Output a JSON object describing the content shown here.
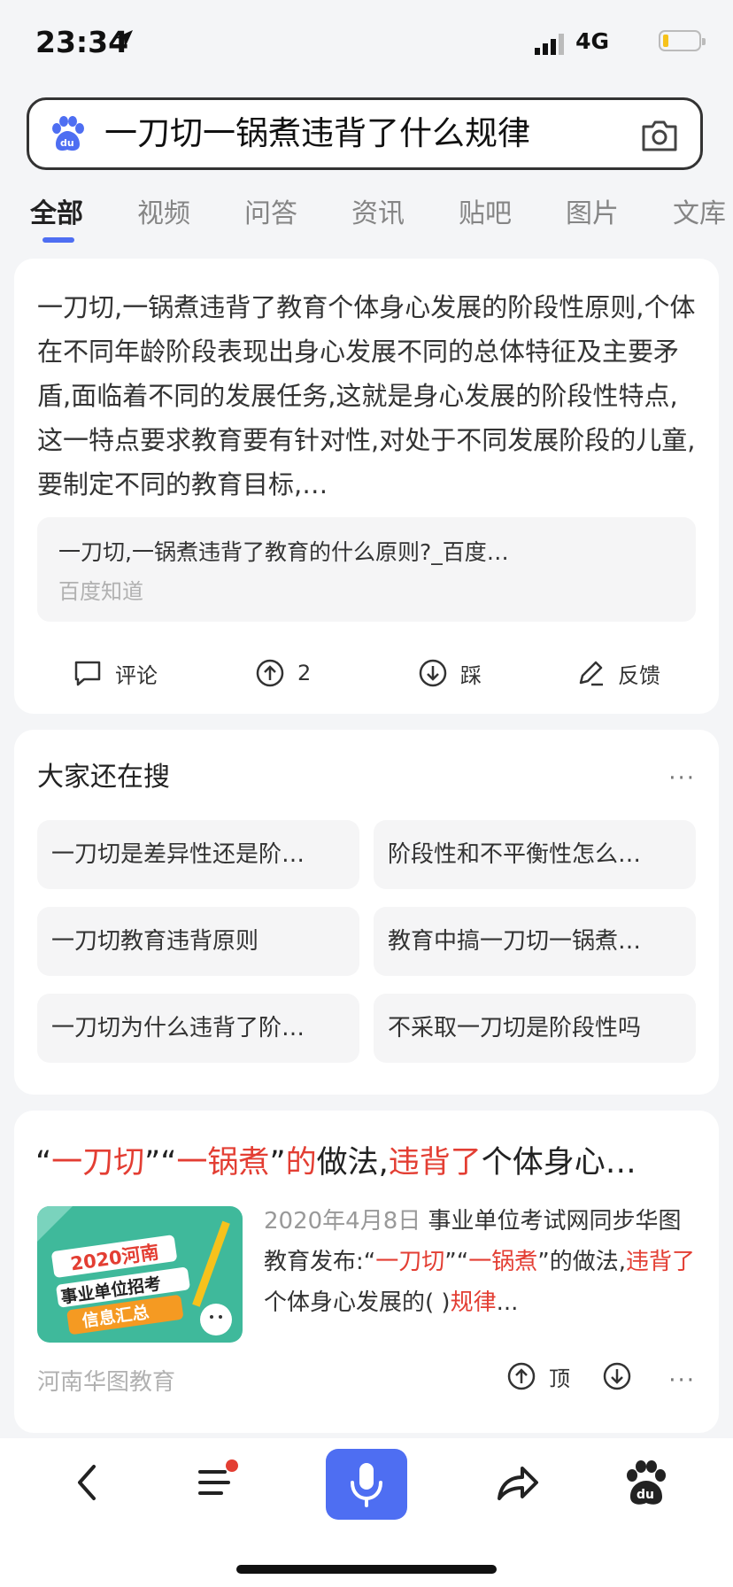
{
  "status": {
    "time": "23:34",
    "network": "4G",
    "battery_level": 0.15
  },
  "search": {
    "query": "一刀切一锅煮违背了什么规律"
  },
  "tabs": [
    "全部",
    "视频",
    "问答",
    "资讯",
    "贴吧",
    "图片",
    "文库"
  ],
  "answer": {
    "text": "一刀切,一锅煮违背了教育个体身心发展的阶段性原则,个体在不同年龄阶段表现出身心发展不同的总体特征及主要矛盾,面临着不同的发展任务,这就是身心发展的阶段性特点,这一特点要求教育要有针对性,对处于不同发展阶段的儿童,要制定不同的教育目标,…",
    "source_title": "一刀切,一锅煮违背了教育的什么原则?_百度…",
    "source_name": "百度知道",
    "actions": {
      "comment": "评论",
      "upvote_count": "2",
      "downvote": "踩",
      "feedback": "反馈"
    }
  },
  "related": {
    "title": "大家还在搜",
    "more": "···",
    "items": [
      "一刀切是差异性还是阶…",
      "阶段性和不平衡性怎么…",
      "一刀切教育违背原则",
      "教育中搞一刀切一锅煮…",
      "一刀切为什么违背了阶…",
      "不采取一刀切是阶段性吗"
    ]
  },
  "result": {
    "title_parts": [
      "“",
      "一刀切",
      "”“",
      "一锅煮",
      "”",
      "的",
      "做法,",
      "违背了",
      "个体身心…"
    ],
    "thumb_text": [
      "2020河南",
      "事业单位招考",
      "信息汇总"
    ],
    "date": "2020年4月8日",
    "snippet_parts": [
      "  事业单位考试网同步华图教育发布:“",
      "一刀切",
      "”“",
      "一锅煮",
      "”的做法,",
      "违背了",
      "个体身心发展的( )",
      "规律",
      "..."
    ],
    "site": "河南华图教育",
    "top_label": "顶",
    "more": "···"
  },
  "colors": {
    "accent": "#4e6ef2",
    "highlight": "#e33e33",
    "notification_dot": "#e33e33"
  }
}
